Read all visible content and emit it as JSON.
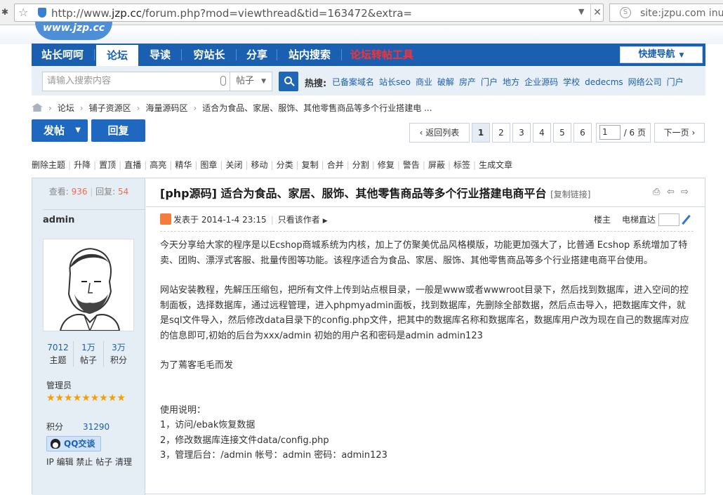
{
  "browser": {
    "url_prefix": "http://www.",
    "url_domain": "jzp.cc",
    "url_rest": "/forum.php?mod=viewthread&tid=163472&extra=",
    "search_text": "site:jzpu.com inurl"
  },
  "site": {
    "logo_fragment": "www.jzp.cc"
  },
  "nav": {
    "items": [
      "站长呵呵",
      "论坛",
      "导读",
      "穷站长",
      "分享",
      "站内搜索",
      "论坛转帖工具"
    ],
    "quick_nav": "快捷导航"
  },
  "search": {
    "placeholder": "请输入搜索内容",
    "scope": "帖子",
    "hot_label": "热搜:",
    "hot_links": [
      "已备案域名",
      "站长seo",
      "商业",
      "破解",
      "房产",
      "门户",
      "地方",
      "企业源码",
      "学校",
      "dedecms",
      "网络公司",
      "门户"
    ]
  },
  "breadcrumb": [
    "论坛",
    "铺子资源区",
    "海量源码区",
    "适合为食品、家居、服饰、其他零售商品等多个行业搭建电 ..."
  ],
  "actions": {
    "post": "发帖",
    "reply": "回复"
  },
  "pager": {
    "back": "返回列表",
    "pages": [
      "1",
      "2",
      "3",
      "4",
      "5",
      "6"
    ],
    "current": "1",
    "input_value": "1",
    "total": "/ 6 页",
    "next": "下一页"
  },
  "mod_tools": [
    "删除主题",
    "升降",
    "置顶",
    "直播",
    "高亮",
    "精华",
    "图章",
    "关闭",
    "移动",
    "分类",
    "复制",
    "合并",
    "分割",
    "修复",
    "警告",
    "屏蔽",
    "标签",
    "生成文章"
  ],
  "thread": {
    "views_label": "查看:",
    "views": "936",
    "replies_label": "回复:",
    "replies": "54",
    "title": "[php源码] 适合为食品、家居、服饰、其他零售商品等多个行业搭建电商平台",
    "copy_link": "[复制链接]",
    "posted": "发表于 2014-1-4 23:15",
    "only_author": "只看该作者",
    "floor_label": "楼主",
    "jump_label": "电梯直达"
  },
  "author": {
    "name": "admin",
    "stats": [
      {
        "value": "7012",
        "label": "主题"
      },
      {
        "value": "1万",
        "label": "帖子"
      },
      {
        "value": "3万",
        "label": "积分"
      }
    ],
    "group": "管理员",
    "stars": "★★★★★★★★★",
    "points_label": "积分",
    "points": "31290",
    "qq": "QQ交谈",
    "admin_links": "IP 编辑 禁止 帖子 清理"
  },
  "content": {
    "p1": "今天分享给大家的程序是以Ecshop商城系统为内核，加上了仿聚美优品风格模版，功能更加强大了，比普通 Ecshop 系统增加了特卖、团购、漂浮式客服、批量传图等功能。该程序适合为食品、家居、服饰、其他零售商品等多个行业搭建电商平台使用。",
    "p2": "网站安装教程，先解压压缩包，把所有文件上传到站点根目录，一般是www或者wwwroot目录下，然后找到数据库，进入空间的控制面板，选择数据库，通过远程管理，进入phpmyadmin面板，找到数据库，先删除全部数据，然后点击导入，把数据库文件，就是sql文件导入，然后修改data目录下的config.php文件，把其中的数据库名称和数据库名，数据库用户改为现在自己的数据库对应的信息即可,初始的后台为xxx/admin 初始的用户名和密码是admin admin123",
    "p3": "为了蔫客毛毛而发",
    "usage_title": "使用说明：",
    "usage": [
      "1，访问/ebak恢复数据",
      "2，修改数据库连接文件data/config.php",
      "3，管理后台：/admin 帐号：admin 密码：admin123"
    ]
  }
}
